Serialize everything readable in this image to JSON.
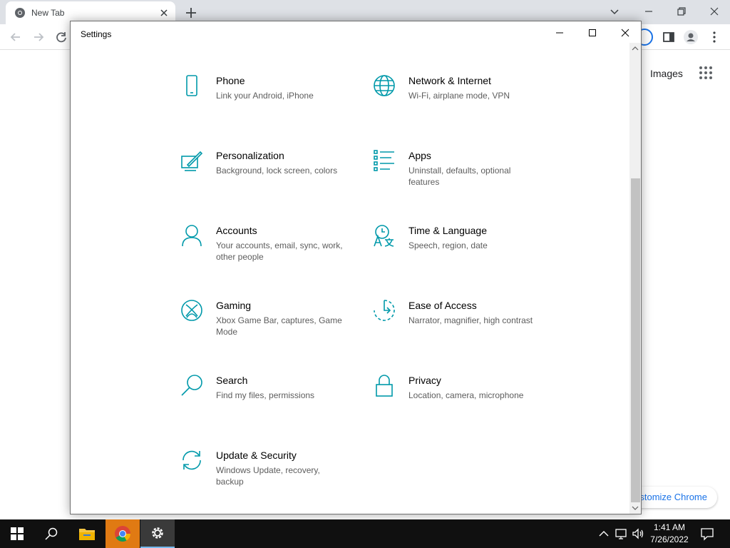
{
  "chrome": {
    "tab_title": "New Tab",
    "images_link": "Images",
    "customize_label": "Customize Chrome"
  },
  "settings": {
    "window_title": "Settings",
    "items": [
      {
        "title": "Phone",
        "desc": "Link your Android, iPhone",
        "icon": "phone-icon"
      },
      {
        "title": "Network & Internet",
        "desc": "Wi-Fi, airplane mode, VPN",
        "icon": "globe-icon"
      },
      {
        "title": "Personalization",
        "desc": "Background, lock screen, colors",
        "icon": "paintbrush-icon"
      },
      {
        "title": "Apps",
        "desc": "Uninstall, defaults, optional features",
        "icon": "apps-list-icon"
      },
      {
        "title": "Accounts",
        "desc": "Your accounts, email, sync, work, other people",
        "icon": "person-icon"
      },
      {
        "title": "Time & Language",
        "desc": "Speech, region, date",
        "icon": "time-language-icon"
      },
      {
        "title": "Gaming",
        "desc": "Xbox Game Bar, captures, Game Mode",
        "icon": "xbox-icon"
      },
      {
        "title": "Ease of Access",
        "desc": "Narrator, magnifier, high contrast",
        "icon": "ease-of-access-icon"
      },
      {
        "title": "Search",
        "desc": "Find my files, permissions",
        "icon": "search-icon"
      },
      {
        "title": "Privacy",
        "desc": "Location, camera, microphone",
        "icon": "lock-icon"
      },
      {
        "title": "Update & Security",
        "desc": "Windows Update, recovery, backup",
        "icon": "sync-icon"
      }
    ]
  },
  "taskbar": {
    "time": "1:41 AM",
    "date": "7/26/2022"
  },
  "colors": {
    "accent": "#0099aa",
    "taskbar": "#101010",
    "chrome_active": "#e07a13"
  }
}
